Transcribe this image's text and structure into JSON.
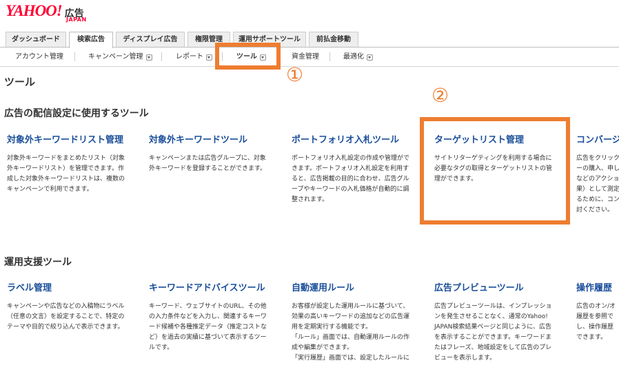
{
  "header": {
    "logo_text": "YAHOO!",
    "logo_sub": "JAPAN",
    "product": "広告"
  },
  "main_tabs": [
    {
      "label": "ダッシュボード"
    },
    {
      "label": "検索広告"
    },
    {
      "label": "ディスプレイ広告"
    },
    {
      "label": "権限管理"
    },
    {
      "label": "運用サポートツール"
    },
    {
      "label": "前払金移動"
    }
  ],
  "sub_nav": [
    {
      "label": "アカウント管理"
    },
    {
      "label": "キャンペーン管理"
    },
    {
      "label": "レポート"
    },
    {
      "label": "ツール"
    },
    {
      "label": "資金管理"
    },
    {
      "label": "最適化"
    }
  ],
  "callouts": {
    "one": "①",
    "two": "②"
  },
  "page_title": "ツール",
  "sections": [
    {
      "title": "広告の配信設定に使用するツール",
      "tools": [
        {
          "title": "対象外キーワードリスト管理",
          "desc": [
            "対象外キーワードをまとめたリスト（対象",
            "外キーワードリスト）を管理できます。作",
            "成した対象外キーワードリストは、複数の",
            "キャンペーンで利用できます。"
          ]
        },
        {
          "title": "対象外キーワードツール",
          "desc": [
            "キャンペーンまたは広告グループに、対象",
            "外キーワードを登録することができます。"
          ]
        },
        {
          "title": "ポートフォリオ入札ツール",
          "desc": [
            "ポートフォリオ入札設定の作成や管理がで",
            "きます。ポートフォリオ入札設定を利用す",
            "ると、広告掲載の目的に合わせ、広告グル",
            "ープやキーワードの入札価格が自動的に調",
            "整されます。"
          ]
        },
        {
          "title": "ターゲットリスト管理",
          "desc": [
            "サイトリターゲティングを利用する場合に",
            "必要なタグの取得とターゲットリストの管",
            "理ができます。"
          ]
        },
        {
          "title": "コンバージ",
          "desc": [
            "広告をクリック",
            "ーの購入、申し",
            "などのアクショ",
            "果）として測定",
            "るために、コン",
            "討ください。"
          ]
        }
      ]
    },
    {
      "title": "運用支援ツール",
      "tools": [
        {
          "title": "ラベル管理",
          "desc": [
            "キャンペーンや広告などの入稿物にラベル",
            "（任意の文言）を設定することで、特定の",
            "テーマや目的で絞り込んで表示できます。"
          ]
        },
        {
          "title": "キーワードアドバイスツール",
          "desc": [
            "キーワード、ウェブサイトのURL、その他",
            "の入力条件などを入力し、関連するキーワ",
            "ード候補や各種推定データ（推定コストな",
            "ど）を過去の実績に基づいて表示するツー",
            "ルです。"
          ]
        },
        {
          "title": "自動運用ルール",
          "desc": [
            "お客様が設定した運用ルールに基づいて、",
            "効果の高いキーワードの追加などの広告運",
            "用を定期実行する機能です。",
            "「ルール」画面では、自動運用ルールの作",
            "成や編集ができます。",
            "「実行履歴」画面では、設定したルールに"
          ]
        },
        {
          "title": "広告プレビューツール",
          "desc": [
            "広告プレビューツールは、インプレッショ",
            "ンを発生させることなく、通常のYahoo!",
            "JAPAN検索結果ページと同じように、広告",
            "を表示することができます。キーワードま",
            "たはフレーズ、地域設定をして広告のプレ",
            "ビューを表示します。"
          ]
        },
        {
          "title": "操作履歴",
          "desc": [
            "広告のオン/オ",
            "履歴を参照で",
            "し、操作履歴",
            "できます。"
          ]
        }
      ]
    }
  ]
}
